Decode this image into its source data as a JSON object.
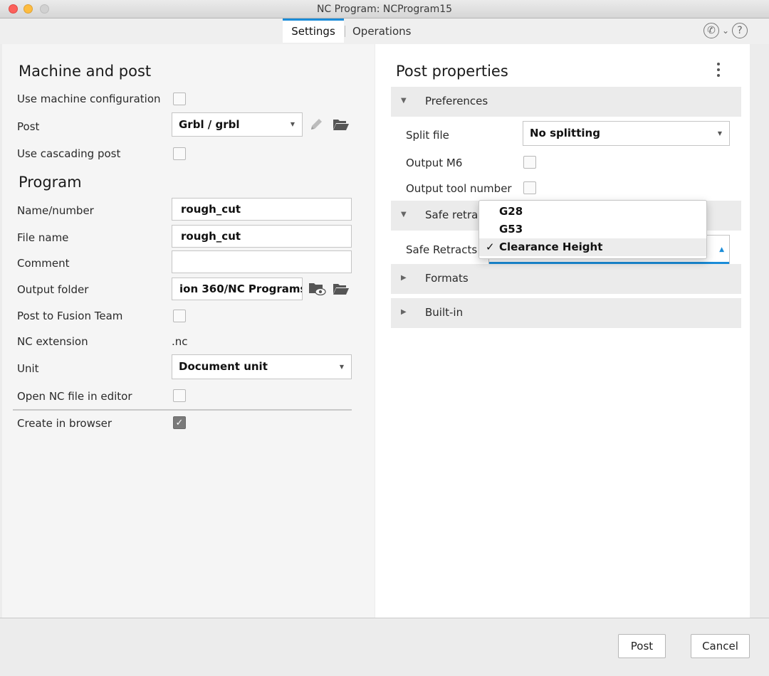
{
  "window": {
    "title": "NC Program: NCProgram15"
  },
  "tabs": [
    {
      "label": "Settings"
    },
    {
      "label": "Operations"
    }
  ],
  "machine_post": {
    "title": "Machine and post",
    "use_machine_config_label": "Use machine configuration",
    "post_label": "Post",
    "post_value": "Grbl / grbl",
    "use_cascading_label": "Use cascading post"
  },
  "program": {
    "title": "Program",
    "name_label": "Name/number",
    "name_value": "rough_cut",
    "file_label": "File name",
    "file_value": "rough_cut",
    "comment_label": "Comment",
    "comment_value": "",
    "output_label": "Output folder",
    "output_value": "ion 360/NC Programs",
    "post_team_label": "Post to Fusion Team",
    "ext_label": "NC extension",
    "ext_value": ".nc",
    "unit_label": "Unit",
    "unit_value": "Document unit",
    "open_editor_label": "Open NC file in editor",
    "create_browser_label": "Create in browser",
    "create_browser_checked": true
  },
  "post_properties": {
    "title": "Post properties",
    "groups": {
      "preferences": "Preferences",
      "safe_retracts": "Safe retrac",
      "formats": "Formats",
      "builtin": "Built-in"
    },
    "split_file_label": "Split file",
    "split_file_value": "No splitting",
    "output_m6_label": "Output M6",
    "output_tool_number_label": "Output tool number",
    "safe_retracts_label": "Safe Retracts"
  },
  "dropdown": {
    "options": [
      "G28",
      "G53",
      "Clearance Height"
    ],
    "selected": "Clearance Height",
    "check_glyph": "✓"
  },
  "buttons": {
    "post": "Post",
    "cancel": "Cancel"
  }
}
